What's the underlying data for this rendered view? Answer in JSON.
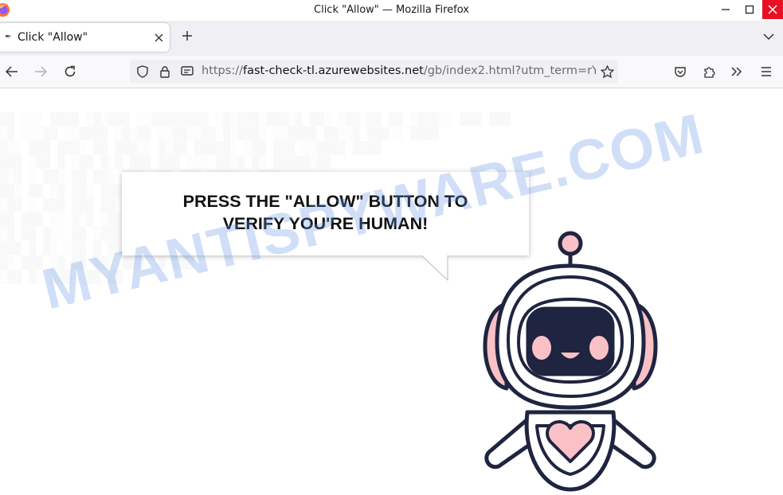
{
  "window": {
    "title": "Click \"Allow\" — Mozilla Firefox"
  },
  "tab": {
    "label": "Click \"Allow\""
  },
  "address_bar": {
    "scheme": "https://",
    "host": "fast-check-tl.azurewebsites.net",
    "path": "/gb/index2.html?utm_term=rY"
  },
  "page": {
    "message_line1": "PRESS THE \"ALLOW\" BUTTON TO",
    "message_line2": "VERIFY YOU'RE HUMAN!",
    "watermark": "MYANTISPYWARE.COM"
  },
  "icons": {
    "close": "close-icon",
    "minimize": "minimize-icon",
    "maximize": "maximize-icon",
    "new_tab": "plus-icon",
    "list_tabs": "chevron-down-icon",
    "back": "arrow-left-icon",
    "forward": "arrow-right-icon",
    "reload": "reload-icon",
    "tracking": "shield-icon",
    "lock": "lock-icon",
    "permissions": "notification-permission-icon",
    "bookmark": "star-icon",
    "pocket": "pocket-icon",
    "extensions": "puzzle-icon",
    "overflow": "chevrons-right-icon",
    "menu": "hamburger-icon"
  },
  "colors": {
    "close_button": "#e81123",
    "robot_outline": "#1f2440",
    "robot_pink": "#f9c1c6",
    "watermark": "#6496e6"
  }
}
